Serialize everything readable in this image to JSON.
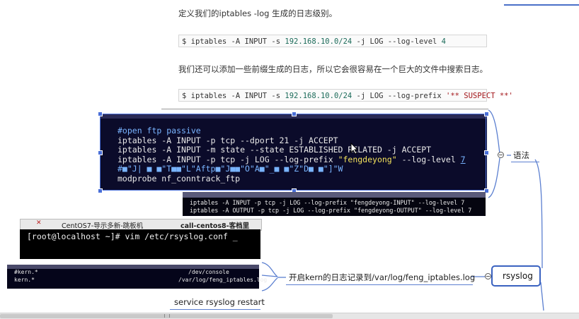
{
  "doc": {
    "para1": "定义我们的iptables -log 生成的日志级别。",
    "code1": {
      "prefix": "$ iptables -A INPUT -s ",
      "ip": "192.168.10.0/24",
      "mid": " -j LOG --log-level ",
      "level": "4"
    },
    "para2": "我们还可以添加一些前缀生成的日志，所以它会很容易在一个巨大的文件中搜索日志。",
    "code2": {
      "prefix": "$ iptables -A INPUT -s ",
      "ip": "192.168.10.0/24",
      "mid": " -j LOG --log-prefix ",
      "str": "'** SUSPECT **'"
    }
  },
  "terminal1": {
    "comment": "#open ftp passive",
    "l1": {
      "cmd": "iptables  -A INPUT  -p tcp  --dport 21  -j ACCEPT"
    },
    "l2": {
      "cmd": "iptables -A INPUT  -m state --state ESTABLISHED RELATED -j ACCEPT"
    },
    "l3": {
      "pre": "iptables -A INPUT -p tcp -j LOG  --log-prefix ",
      "str": "\"fengdeyong\"",
      "post": "  --log-level ",
      "num": "7"
    },
    "garbled": "#■\"J| ■ ■\"T■■\"L\"Aftp■\"J■■\"O\"A■\"_■ ■\"Z\"D■ ■\"]\"W",
    "l5": "modprobe nf_conntrack_ftp"
  },
  "terminal2": {
    "l1": "iptables -A INPUT -p tcp -j LOG --log-prefix \"fengdeyong-INPUT\"  --log-level 7",
    "l2": "iptables -A OUTPUT -p tcp -j LOG --log-prefix \"fengdeyong-OUTPUT\"  --log-level 7"
  },
  "tabs": {
    "tab1": "CentOS7-导示多新-跳板机",
    "tab2": "call-centos8-客档里"
  },
  "terminal3": {
    "prompt": "[root@localhost ~]# vim /etc/rsyslog.conf _"
  },
  "terminal4": {
    "col1a": "#kern.*",
    "col2a": "/dev/console",
    "col1b": "kern.*",
    "col2b": "/var/log/feng_iptables.log"
  },
  "mindmap": {
    "syntax_node": "语法",
    "kern_node": "开启kern的日志记录到/var/log/feng_iptables.log",
    "restart_node": "service rsyslog restart",
    "rsyslog_node": "rsyslog"
  },
  "colors": {
    "accent": "#3a62c0",
    "line": "#5b7fd0",
    "terminal_bg": "#0b0b2a"
  }
}
